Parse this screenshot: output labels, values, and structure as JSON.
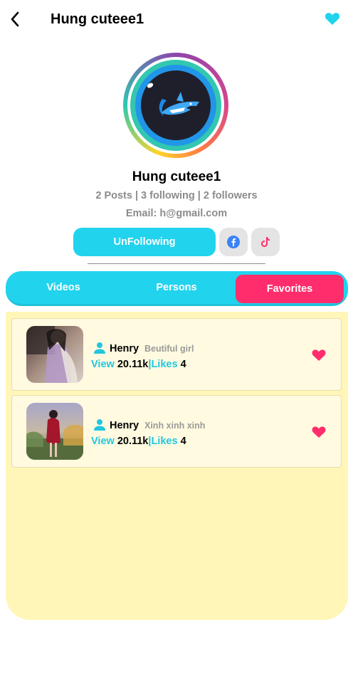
{
  "header": {
    "title": "Hung cuteee1",
    "back_icon": "chevron-left-icon",
    "favorite_icon": "heart-icon"
  },
  "profile": {
    "name": "Hung cuteee1",
    "stats": "2 Posts | 3 following | 2 followers",
    "email": "Email: h@gmail.com",
    "avatar_icon": "shark-logo"
  },
  "actions": {
    "unfollow_label": "UnFollowing",
    "facebook_icon": "facebook-icon",
    "tiktok_icon": "tiktok-icon"
  },
  "tabs": [
    {
      "label": "Videos",
      "active": false
    },
    {
      "label": "Persons",
      "active": false
    },
    {
      "label": "Favorites",
      "active": true
    }
  ],
  "favorites": [
    {
      "user": "Henry",
      "description": "Beutiful girl",
      "view_label": "View",
      "views": "20.11k",
      "separator": "|",
      "likes_label": "Likes",
      "likes": "4"
    },
    {
      "user": "Henry",
      "description": "Xinh xinh xinh",
      "view_label": "View",
      "views": "20.11k",
      "separator": "|",
      "likes_label": "Likes",
      "likes": "4"
    }
  ],
  "colors": {
    "accent": "#22d3ee",
    "active_tab": "#ff2d6b",
    "panel": "#fff6b8",
    "heart": "#ff2d6b"
  }
}
